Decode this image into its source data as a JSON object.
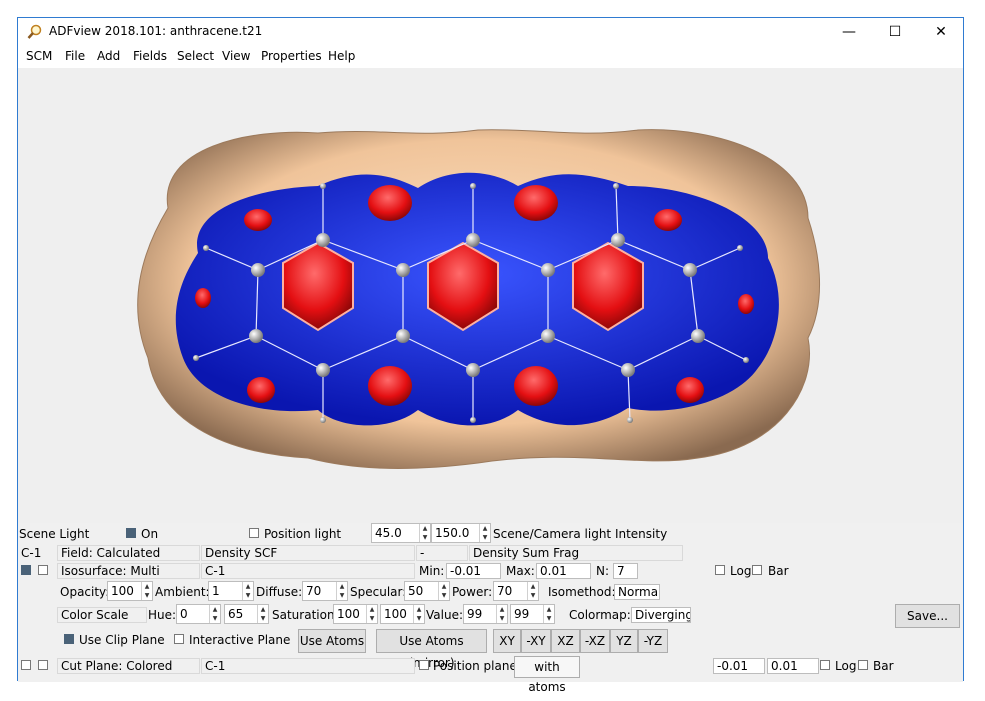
{
  "window": {
    "title": "ADFview 2018.101: anthracene.t21",
    "minimize_glyph": "—",
    "maximize_glyph": "☐",
    "close_glyph": "✕"
  },
  "menu": [
    {
      "label": "SCM",
      "key": "S"
    },
    {
      "label": "File",
      "key": "F"
    },
    {
      "label": "Add",
      "key": "A"
    },
    {
      "label": "Fields",
      "key": "F"
    },
    {
      "label": "Select",
      "key": "S"
    },
    {
      "label": "View",
      "key": "V"
    },
    {
      "label": "Properties",
      "key": "P"
    },
    {
      "label": "Help",
      "key": "H"
    }
  ],
  "scene": {
    "label": "Scene Light",
    "on_label": "On",
    "on_checked": true,
    "position_light_label": "Position light",
    "position_light_checked": false,
    "intensity1": "45.0",
    "intensity2": "150.0",
    "intensity_label": "Scene/Camera light Intensity"
  },
  "field_row": {
    "id": "C-1",
    "field": "Field: Calculated",
    "density": "Density SCF",
    "dash": "-",
    "frag": "Density Sum Frag"
  },
  "iso_row": {
    "iso": "Isosurface: Multi",
    "id": "C-1",
    "min_label": "Min:",
    "min_value": "-0.01",
    "max_label": "Max:",
    "max_value": "0.01",
    "n_label": "N:",
    "n_value": "7",
    "log_label": "Log",
    "bar_label": "Bar"
  },
  "material": {
    "opacity_label": "Opacity:",
    "opacity": "100",
    "ambient_label": "Ambient:",
    "ambient": "1",
    "diffuse_label": "Diffuse:",
    "diffuse": "70",
    "specular_label": "Specular:",
    "specular": "50",
    "power_label": "Power:",
    "power": "70",
    "isomethod_label": "Isomethod:",
    "isomethod": "Normal"
  },
  "color": {
    "scale": "Color Scale",
    "hue_label": "Hue:",
    "hue1": "0",
    "hue2": "65",
    "saturation_label": "Saturation:",
    "sat1": "100",
    "sat2": "100",
    "value_label": "Value:",
    "val1": "99",
    "val2": "99",
    "colormap_label": "Colormap:",
    "colormap": "Diverging",
    "save_label": "Save..."
  },
  "clip": {
    "use_clip_label": "Use Clip Plane",
    "use_clip_checked": true,
    "interactive_label": "Interactive Plane",
    "use_atoms": "Use Atoms",
    "use_atoms_mirror": "Use Atoms (mirror)",
    "axes": [
      "XY",
      "-XY",
      "XZ",
      "-XZ",
      "YZ",
      "-YZ"
    ]
  },
  "cut": {
    "label": "Cut Plane: Colored",
    "id": "C-1",
    "position_plane_label": "Position plane",
    "with_atoms": "with atoms",
    "min": "-0.01",
    "max": "0.01",
    "log_label": "Log",
    "bar_label": "Bar"
  },
  "colors": {
    "accent": "#2f7bd1",
    "surface_outer": "#f0c8a0",
    "surface_blue": "#0a1fd8",
    "surface_red": "#e40f12",
    "atom": "#c8c8c8"
  }
}
